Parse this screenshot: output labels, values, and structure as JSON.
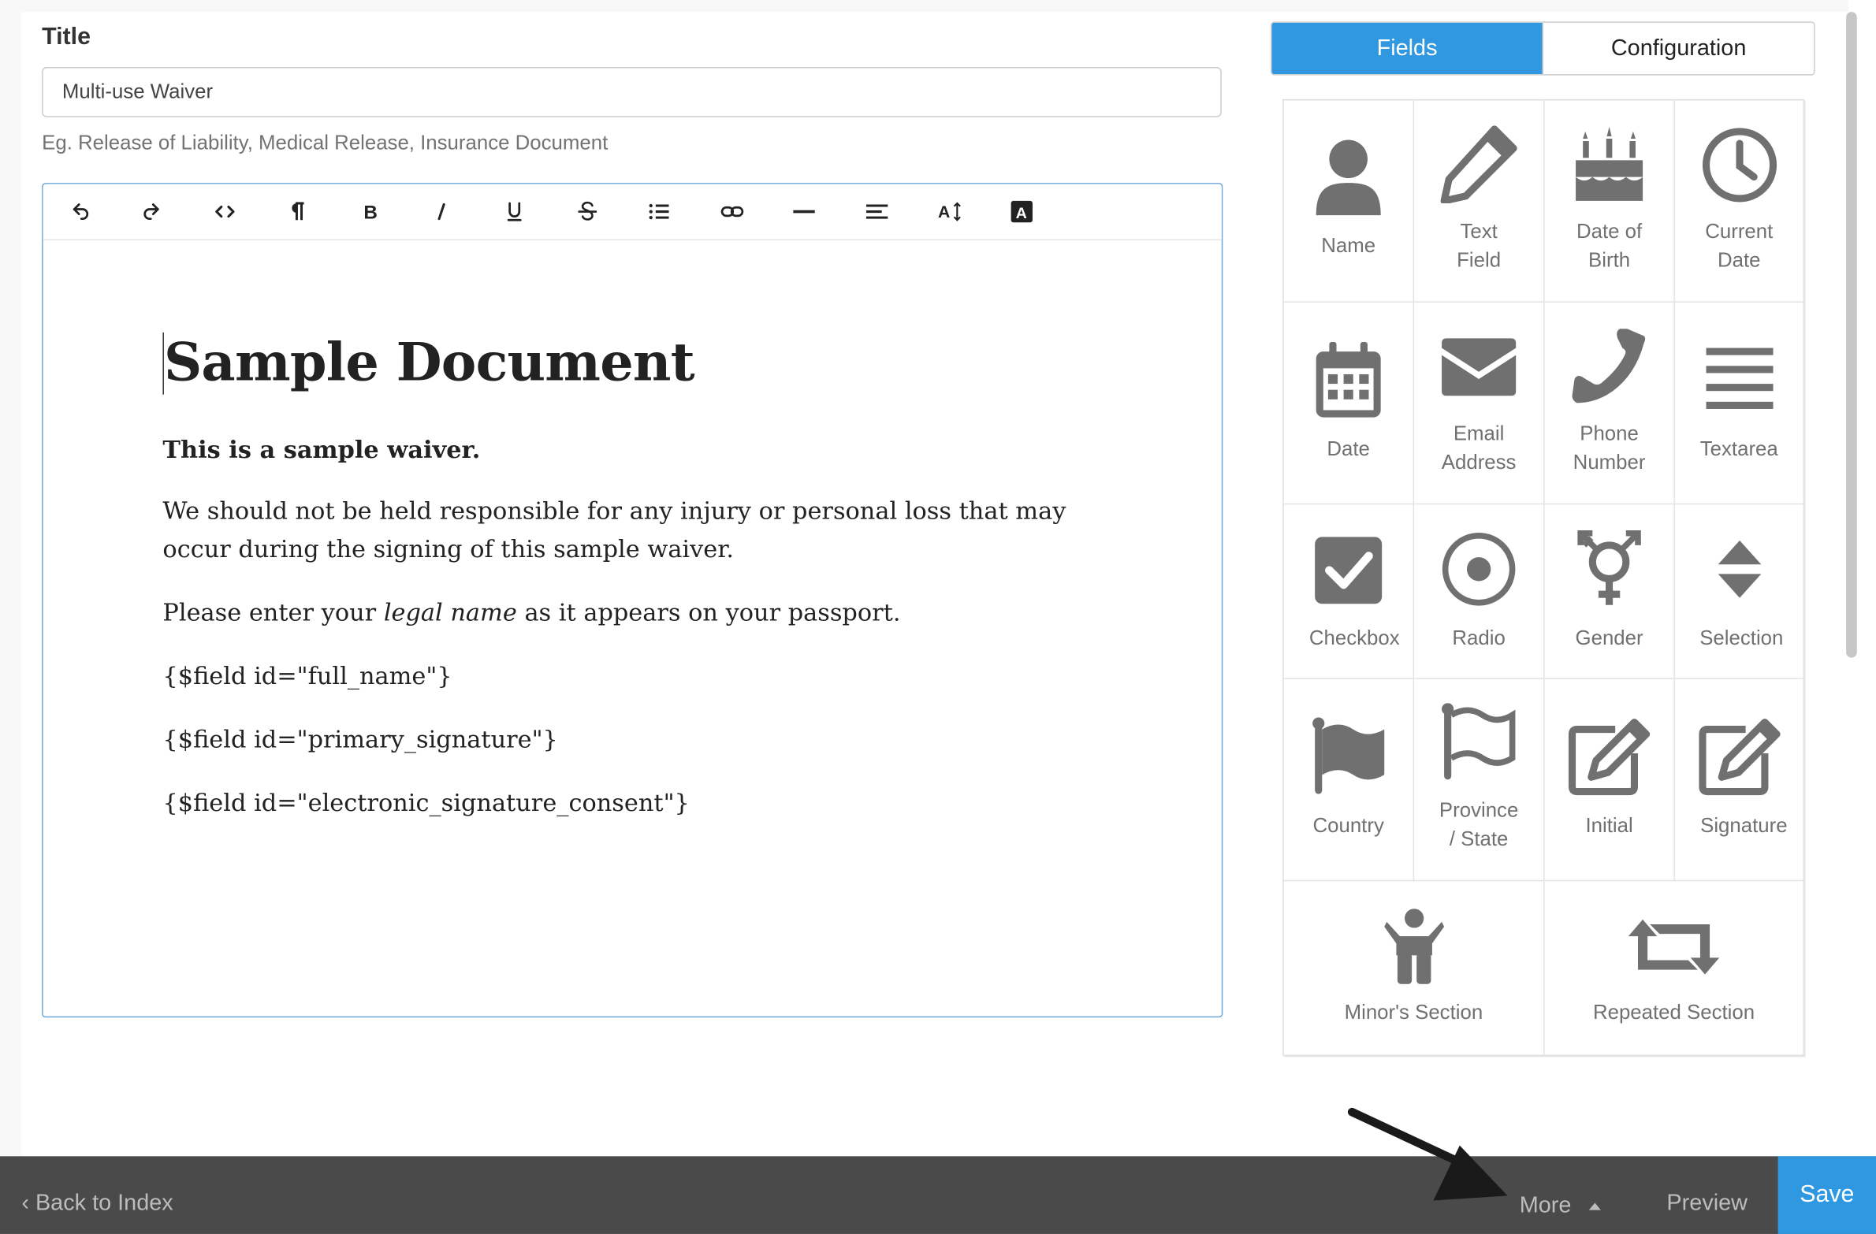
{
  "form": {
    "title_label": "Title",
    "title_value": "Multi-use Waiver",
    "title_hint": "Eg. Release of Liability, Medical Release, Insurance Document"
  },
  "editor": {
    "toolbar": [
      "undo-icon",
      "redo-icon",
      "code-icon",
      "paragraph-icon",
      "bold-icon",
      "italic-icon",
      "underline-icon",
      "strikethrough-icon",
      "list-icon",
      "link-icon",
      "horizontal-rule-icon",
      "align-icon",
      "font-size-icon",
      "text-color-icon"
    ],
    "document": {
      "heading": "Sample Document",
      "bold_line": "This is a sample waiver.",
      "paragraph1": "We should not be held responsible for any injury or personal loss that may occur during the signing of this sample waiver.",
      "para2_before": "Please enter your ",
      "para2_italic": "legal name",
      "para2_after": " as it appears on your passport.",
      "field1": "{$field id=\"full_name\"}",
      "field2": "{$field id=\"primary_signature\"}",
      "field3": "{$field id=\"electronic_signature_consent\"}"
    }
  },
  "tabs": {
    "fields": "Fields",
    "configuration": "Configuration"
  },
  "fields": {
    "name": "Name",
    "text_field_1": "Text",
    "text_field_2": "Field",
    "dob_1": "Date of",
    "dob_2": "Birth",
    "current_date_1": "Current",
    "current_date_2": "Date",
    "date": "Date",
    "email_1": "Email",
    "email_2": "Address",
    "phone_1": "Phone",
    "phone_2": "Number",
    "textarea": "Textarea",
    "checkbox": "Checkbox",
    "radio": "Radio",
    "gender": "Gender",
    "selection": "Selection",
    "country": "Country",
    "province_1": "Province",
    "province_2": "/ State",
    "initial": "Initial",
    "signature": "Signature",
    "minor": "Minor's Section",
    "repeated": "Repeated Section"
  },
  "bottombar": {
    "back": "Back to Index",
    "more": "More",
    "preview": "Preview",
    "save": "Save"
  },
  "colors": {
    "accent": "#2f98e0",
    "icon": "#707070",
    "bar": "#4a4a4a"
  }
}
